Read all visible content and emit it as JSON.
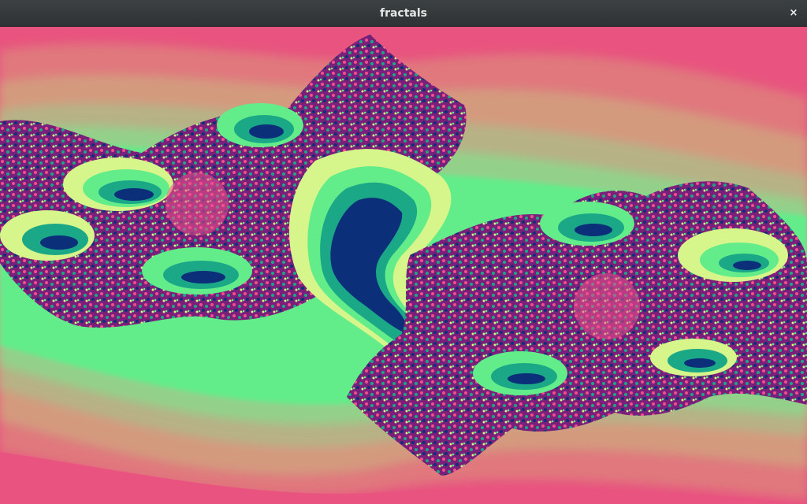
{
  "window": {
    "title": "fractals",
    "close_glyph": "×",
    "close_icon": "close-icon"
  },
  "fractal": {
    "type": "julia-set",
    "palette": {
      "outer": "#e8547f",
      "outer2": "#d98b7c",
      "band1": "#b9ad85",
      "band2": "#93d18a",
      "band3": "#63ec8a",
      "band4": "#d6f58a",
      "teal": "#1aa887",
      "navy": "#0c2f7a",
      "purple": "#7a1f7a",
      "pink": "#f0508c"
    }
  }
}
